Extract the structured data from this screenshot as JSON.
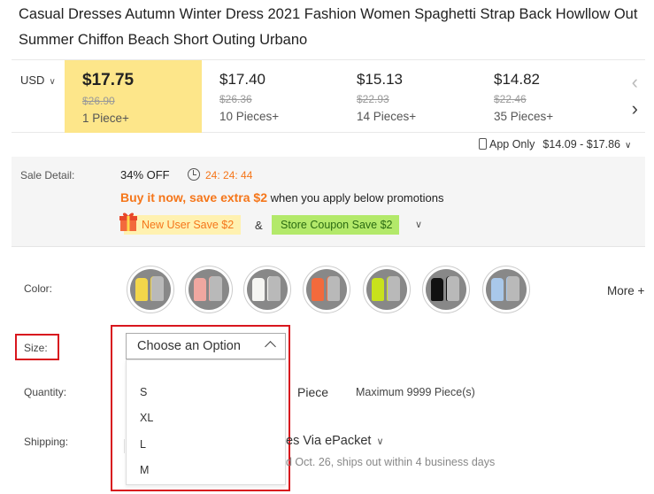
{
  "product": {
    "title": "Casual Dresses Autumn Winter Dress 2021 Fashion Women Spaghetti Strap Back Howllow Out Summer Chiffon Beach Short Outing Urbano"
  },
  "pricing": {
    "currency": "USD",
    "tiers": [
      {
        "price": "$17.75",
        "original": "$26.90",
        "quantity": "1 Piece+",
        "selected": true
      },
      {
        "price": "$17.40",
        "original": "$26.36",
        "quantity": "10 Pieces+",
        "selected": false
      },
      {
        "price": "$15.13",
        "original": "$22.93",
        "quantity": "14 Pieces+",
        "selected": false
      },
      {
        "price": "$14.82",
        "original": "$22.46",
        "quantity": "35 Pieces+",
        "selected": false
      }
    ],
    "app_only_label": "App Only",
    "app_only_range": "$14.09 - $17.86"
  },
  "sale": {
    "label": "Sale Detail:",
    "discount": "34% OFF",
    "countdown": "24: 24: 44",
    "promo_highlight": "Buy it now, save extra $2",
    "promo_text": " when you apply below promotions",
    "new_user_coupon": "New User Save $2",
    "ampersand": "&",
    "store_coupon": "Store Coupon Save $2"
  },
  "color": {
    "label": "Color:",
    "swatches": [
      "#f3d64a",
      "#f0a7a0",
      "#f5f5f2",
      "#f36a3c",
      "#c8e21c",
      "#111111",
      "#a9c8ea"
    ],
    "more_label": "More"
  },
  "size": {
    "label": "Size:",
    "placeholder": "Choose an Option",
    "options": [
      "S",
      "XL",
      "L",
      "M"
    ]
  },
  "quantity": {
    "label": "Quantity:",
    "unit": "Piece",
    "max": "Maximum 9999 Piece(s)"
  },
  "shipping": {
    "label": "Shipping:",
    "method": "es Via ePacket",
    "eta": "d Oct. 26, ships out within 4 business days"
  },
  "colors": {
    "accent_orange": "#f5761a",
    "active_tier_bg": "#fde68a",
    "highlight_red": "#d8161e",
    "store_coupon_bg": "#b3e96a"
  }
}
